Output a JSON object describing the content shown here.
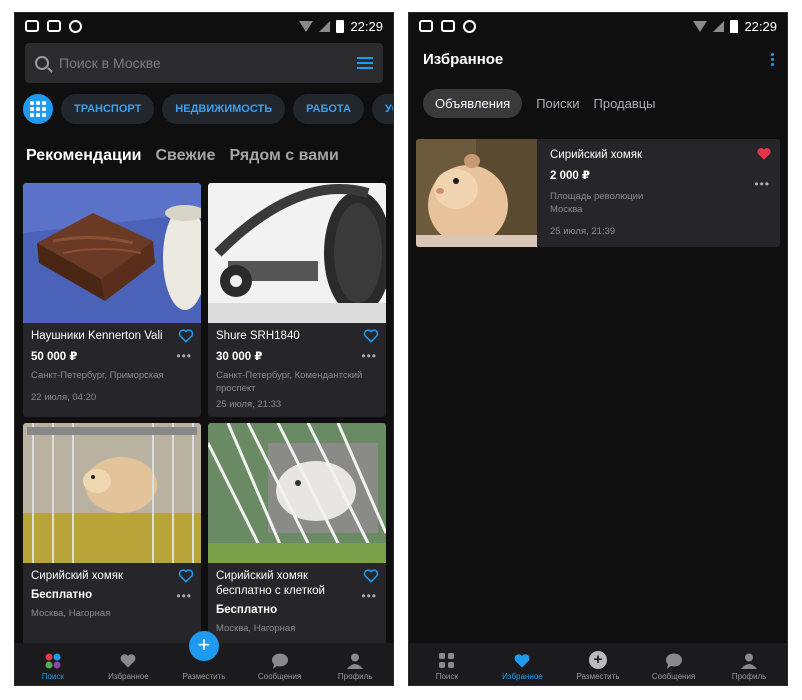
{
  "status": {
    "time": "22:29"
  },
  "screen1": {
    "search_placeholder": "Поиск в Москве",
    "categories": [
      "ТРАНСПОРТ",
      "НЕДВИЖИМОСТЬ",
      "РАБОТА",
      "УСЛУ"
    ],
    "tabs": [
      "Рекомендации",
      "Свежие",
      "Рядом с вами"
    ],
    "cards": [
      {
        "title": "Наушники Kennerton Vali",
        "price": "50 000 ₽",
        "location": "Санкт-Петербург, Приморская",
        "date": "22 июля, 04:20"
      },
      {
        "title": "Shure SRH1840",
        "price": "30 000 ₽",
        "location": "Санкт-Петербург, Комендантский проспект",
        "date": "25 июля, 21:33"
      },
      {
        "title": "Сирийский хомяк",
        "price": "Бесплатно",
        "location": "Москва, Нагорная",
        "date": ""
      },
      {
        "title": "Сирийский хомяк бесплатно с клеткой",
        "price": "Бесплатно",
        "location": "Москва, Нагорная",
        "date": ""
      }
    ]
  },
  "screen2": {
    "title": "Избранное",
    "tabs": [
      "Объявления",
      "Поиски",
      "Продавцы"
    ],
    "card": {
      "title": "Сирийский хомяк",
      "price": "2 000 ₽",
      "location_line1": "Площадь революции",
      "location_line2": "Москва",
      "date": "25 июля, 21:39"
    }
  },
  "nav": [
    "Поиск",
    "Избранное",
    "Разместить",
    "Сообщения",
    "Профиль"
  ],
  "colors": {
    "accent": "#1e9bf0",
    "favorite": "#e8344a",
    "background": "#0f0f10",
    "card": "#26262a"
  }
}
